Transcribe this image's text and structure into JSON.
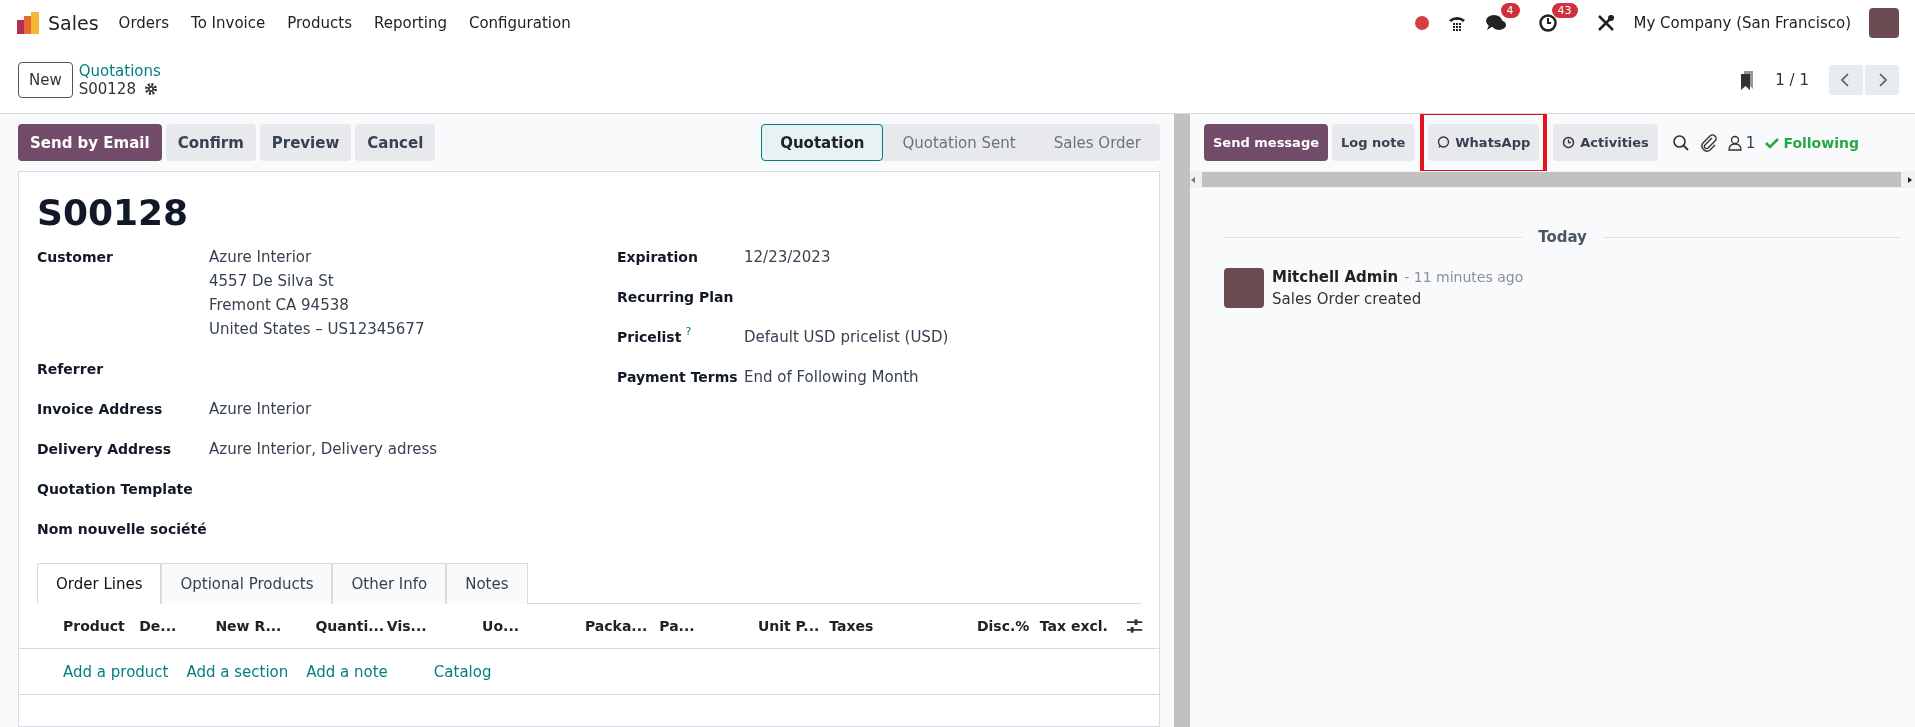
{
  "navbar": {
    "app": "Sales",
    "menus": [
      "Orders",
      "To Invoice",
      "Products",
      "Reporting",
      "Configuration"
    ],
    "messages_badge": "4",
    "activities_badge": "43",
    "company": "My Company (San Francisco)"
  },
  "control_panel": {
    "new_button": "New",
    "breadcrumb": "Quotations",
    "record": "S00128",
    "pager": "1 / 1"
  },
  "actions": [
    "Send by Email",
    "Confirm",
    "Preview",
    "Cancel"
  ],
  "statusbar": [
    {
      "label": "Quotation",
      "selected": true
    },
    {
      "label": "Quotation Sent",
      "selected": false
    },
    {
      "label": "Sales Order",
      "selected": false
    }
  ],
  "form": {
    "title": "S00128",
    "left_fields": [
      {
        "label": "Customer",
        "lines": [
          "Azure Interior",
          "4557 De Silva St",
          "Fremont CA 94538",
          "United States – US12345677"
        ]
      },
      {
        "label": "Referrer"
      },
      {
        "label": "Invoice Address",
        "lines": [
          "Azure Interior"
        ]
      },
      {
        "label": "Delivery Address",
        "lines": [
          "Azure Interior, Delivery adress"
        ]
      },
      {
        "label": "Quotation Template"
      },
      {
        "label": "Nom nouvelle société"
      }
    ],
    "right_fields": [
      {
        "label": "Expiration",
        "value": "12/23/2023"
      },
      {
        "label": "Recurring Plan"
      },
      {
        "label": "Pricelist",
        "help_mark": "?",
        "value": "Default USD pricelist (USD)"
      },
      {
        "label": "Payment Terms",
        "value": "End of Following Month"
      }
    ],
    "tabs": [
      {
        "label": "Order Lines",
        "selected": true
      },
      {
        "label": "Optional Products",
        "selected": false
      },
      {
        "label": "Other Info",
        "selected": false
      },
      {
        "label": "Notes",
        "selected": false
      }
    ],
    "columns": [
      "Product",
      "De...",
      "New R...",
      "Quanti...",
      "Vis...",
      "Uo...",
      "Packa...",
      "Pa...",
      "Unit P...",
      "Taxes",
      "Disc.%",
      "Tax excl."
    ],
    "add_links": [
      "Add a product",
      "Add a section",
      "Add a note",
      "Catalog"
    ]
  },
  "chatter": {
    "buttons": [
      {
        "label": "Send message",
        "kind": "primary",
        "highlighted": false
      },
      {
        "label": "Log note",
        "kind": "plain",
        "highlighted": false
      },
      {
        "label": "WhatsApp",
        "kind": "whatsapp",
        "highlighted": true
      },
      {
        "label": "Activities",
        "kind": "activities",
        "highlighted": false
      }
    ],
    "followers_count": "1",
    "following": "Following",
    "date_separator": "Today",
    "messages": [
      {
        "author": "Mitchell Admin",
        "time": "- 11 minutes ago",
        "body": "Sales Order created"
      }
    ]
  }
}
